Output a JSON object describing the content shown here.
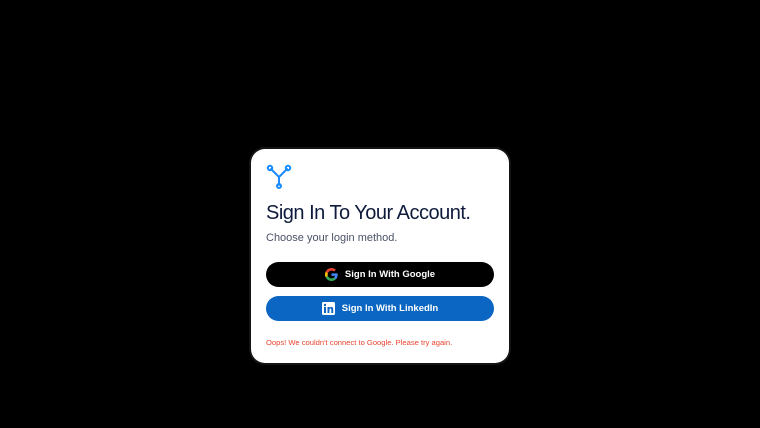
{
  "login": {
    "title": "Sign In To Your Account.",
    "subtitle": "Choose your login method.",
    "google_button_label": "Sign In With Google",
    "linkedin_button_label": "Sign In With LinkedIn",
    "error_message": "Oops! We couldn't connect to Google. Please try again."
  },
  "icons": {
    "logo": "tri-branch-logo-icon",
    "google": "google-g-icon",
    "linkedin": "linkedin-icon"
  },
  "colors": {
    "background": "#000000",
    "card": "#ffffff",
    "title": "#0f1b3d",
    "google_button": "#000000",
    "linkedin_button": "#0a66c2",
    "logo_accent": "#1a8cff",
    "error": "#e8432e"
  }
}
